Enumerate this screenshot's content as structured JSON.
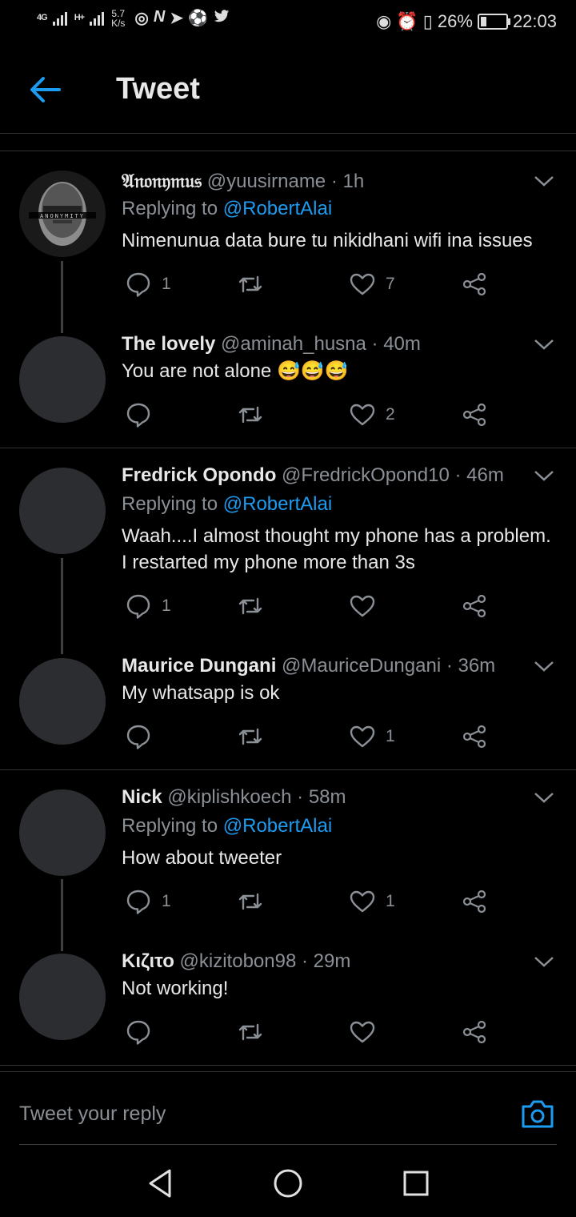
{
  "status": {
    "net1": "4G",
    "net2": "H+",
    "speed": "5.7",
    "speed_unit": "K/s",
    "battery": "26%",
    "battery_level": 0.26,
    "time": "22:03"
  },
  "header": {
    "title": "Tweet"
  },
  "tweets": [
    {
      "name": "𝔄𝔫𝔬𝔫𝔶𝔪𝔲𝔰",
      "handle": "@yuusirname",
      "time": "· 1h",
      "replying_prefix": "Replying to",
      "replying_to": "@RobertAlai",
      "text": "Nimenunua data bure tu nikidhani wifi ina issues",
      "replies": "1",
      "retweets": "",
      "likes": "7"
    },
    {
      "name": "The lovely",
      "handle": "@aminah_husna",
      "time": "· 40m",
      "text": "You are not alone 😅😅😅",
      "replies": "",
      "retweets": "",
      "likes": "2"
    },
    {
      "name": "Fredrick Opondo",
      "handle": "@FredrickOpond10",
      "time": "· 46m",
      "replying_prefix": "Replying to",
      "replying_to": "@RobertAlai",
      "text": "Waah....I almost thought my phone has a problem. I restarted my phone more than 3s",
      "replies": "1",
      "retweets": "",
      "likes": ""
    },
    {
      "name": "Maurice Dungani",
      "handle": "@MauriceDungani",
      "time": "· 36m",
      "text": "My whatsapp is ok",
      "replies": "",
      "retweets": "",
      "likes": "1"
    },
    {
      "name": "Nick",
      "handle": "@kiplishkoech",
      "time": "· 58m",
      "replying_prefix": "Replying to",
      "replying_to": "@RobertAlai",
      "text": "How about tweeter",
      "replies": "1",
      "retweets": "",
      "likes": "1"
    },
    {
      "name": "Κιζιτο",
      "handle": "@kizitobon98",
      "time": "· 29m",
      "text": "Not working!",
      "replies": "",
      "retweets": "",
      "likes": ""
    }
  ],
  "reply_box": {
    "placeholder": "Tweet your reply"
  },
  "colors": {
    "accent": "#1d9bf0",
    "muted": "#8b9096",
    "background": "#000000"
  },
  "icons": [
    "arrow-left-icon",
    "chevron-down-icon",
    "reply-icon",
    "retweet-icon",
    "heart-icon",
    "share-icon",
    "camera-icon"
  ]
}
